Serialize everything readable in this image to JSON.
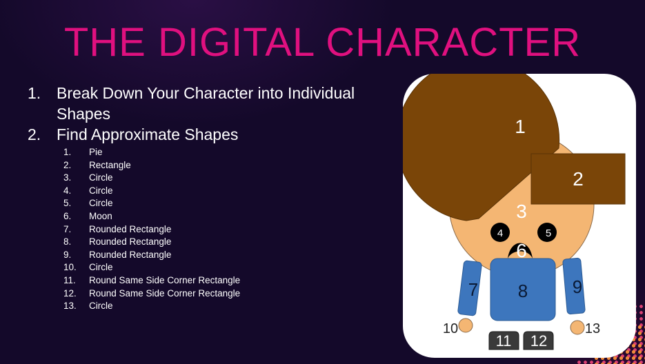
{
  "title": "THE DIGITAL CHARACTER",
  "steps": [
    {
      "num": "1.",
      "text": "Break Down Your Character into Individual Shapes"
    },
    {
      "num": "2.",
      "text": "Find Approximate Shapes"
    }
  ],
  "shapes": [
    {
      "num": "1.",
      "text": "Pie"
    },
    {
      "num": "2.",
      "text": "Rectangle"
    },
    {
      "num": "3.",
      "text": "Circle"
    },
    {
      "num": "4.",
      "text": "Circle"
    },
    {
      "num": "5.",
      "text": "Circle"
    },
    {
      "num": "6.",
      "text": "Moon"
    },
    {
      "num": "7.",
      "text": "Rounded Rectangle"
    },
    {
      "num": "8.",
      "text": "Rounded Rectangle"
    },
    {
      "num": "9.",
      "text": "Rounded Rectangle"
    },
    {
      "num": "10.",
      "text": "Circle"
    },
    {
      "num": "11.",
      "text": "Round Same Side Corner Rectangle"
    },
    {
      "num": "12.",
      "text": "Round Same Side Corner Rectangle"
    },
    {
      "num": "13.",
      "text": "Circle"
    }
  ],
  "diagram_labels": {
    "l1": "1",
    "l2": "2",
    "l3": "3",
    "l4": "4",
    "l5": "5",
    "l6": "6",
    "l7": "7",
    "l8": "8",
    "l9": "9",
    "l10": "10",
    "l11": "11",
    "l12": "12",
    "l13": "13"
  },
  "colors": {
    "background": "#14092a",
    "title": "#e0107f",
    "hair": "#7a4508",
    "skin": "#f4b673",
    "body": "#3d76bd",
    "feet": "#3a3a3a",
    "card": "#ffffff"
  }
}
